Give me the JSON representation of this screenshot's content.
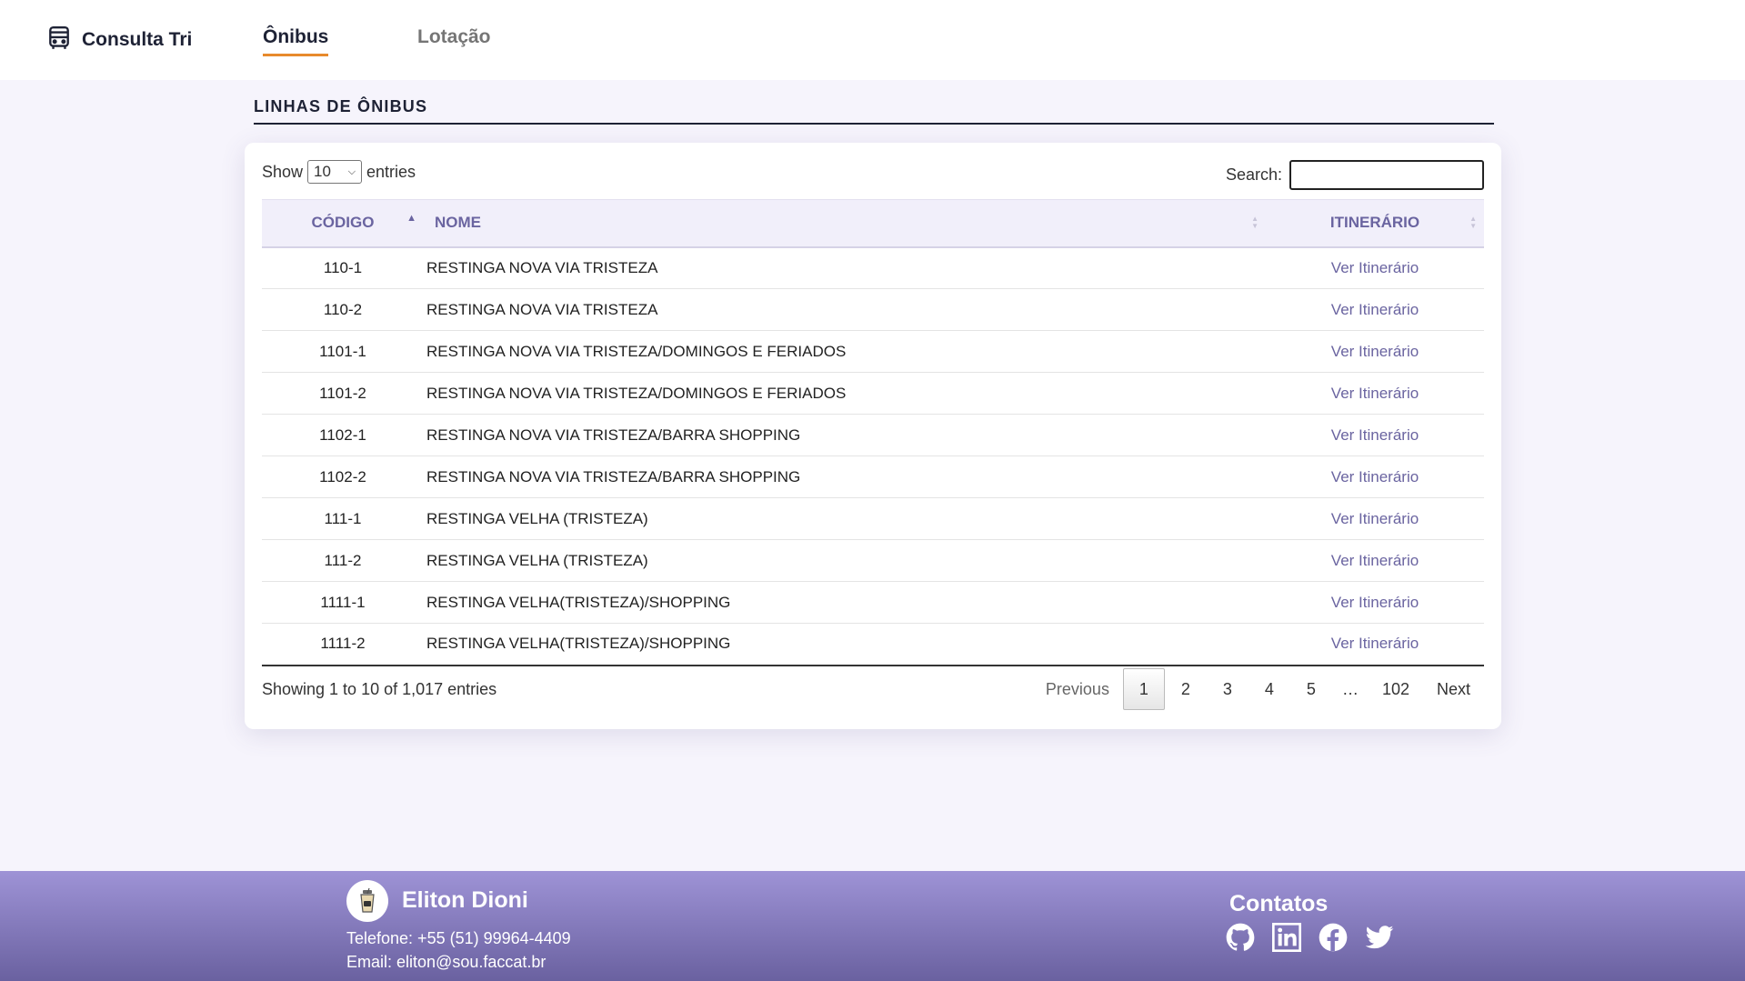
{
  "header": {
    "brand": "Consulta Tri",
    "tabs": [
      {
        "label": "Ônibus",
        "active": true
      },
      {
        "label": "Lotação",
        "active": false
      }
    ]
  },
  "section_title": "LINHAS DE ÔNIBUS",
  "table_controls": {
    "show_label": "Show",
    "entries_label": "entries",
    "page_length": "10",
    "search_label": "Search:",
    "search_value": ""
  },
  "table": {
    "columns": [
      "CÓDIGO",
      "NOME",
      "ITINERÁRIO"
    ],
    "rows": [
      {
        "code": "110-1",
        "name": "RESTINGA NOVA VIA TRISTEZA",
        "link": "Ver Itinerário"
      },
      {
        "code": "110-2",
        "name": "RESTINGA NOVA VIA TRISTEZA",
        "link": "Ver Itinerário"
      },
      {
        "code": "1101-1",
        "name": "RESTINGA NOVA VIA TRISTEZA/DOMINGOS E FERIADOS",
        "link": "Ver Itinerário"
      },
      {
        "code": "1101-2",
        "name": "RESTINGA NOVA VIA TRISTEZA/DOMINGOS E FERIADOS",
        "link": "Ver Itinerário"
      },
      {
        "code": "1102-1",
        "name": "RESTINGA NOVA VIA TRISTEZA/BARRA SHOPPING",
        "link": "Ver Itinerário"
      },
      {
        "code": "1102-2",
        "name": "RESTINGA NOVA VIA TRISTEZA/BARRA SHOPPING",
        "link": "Ver Itinerário"
      },
      {
        "code": "111-1",
        "name": "RESTINGA VELHA (TRISTEZA)",
        "link": "Ver Itinerário"
      },
      {
        "code": "111-2",
        "name": "RESTINGA VELHA (TRISTEZA)",
        "link": "Ver Itinerário"
      },
      {
        "code": "1111-1",
        "name": "RESTINGA VELHA(TRISTEZA)/SHOPPING",
        "link": "Ver Itinerário"
      },
      {
        "code": "1111-2",
        "name": "RESTINGA VELHA(TRISTEZA)/SHOPPING",
        "link": "Ver Itinerário"
      }
    ]
  },
  "info": "Showing 1 to 10 of 1,017 entries",
  "pagination": {
    "previous": "Previous",
    "pages": [
      "1",
      "2",
      "3",
      "4",
      "5"
    ],
    "ellipsis": "…",
    "last": "102",
    "next": "Next",
    "current": "1"
  },
  "footer": {
    "name": "Eliton Dioni",
    "phone": "Telefone: +55 (51) 99964-4409",
    "email": "Email: eliton@sou.faccat.br",
    "contacts_title": "Contatos",
    "social_icons": [
      "github-icon",
      "linkedin-icon",
      "facebook-icon",
      "twitter-icon"
    ]
  },
  "colors": {
    "accent_underline": "#e88a2c",
    "table_header_text": "#6a64a0",
    "link": "#6a64a0",
    "footer_top": "#9e93d6",
    "footer_bottom": "#6a61a0"
  }
}
